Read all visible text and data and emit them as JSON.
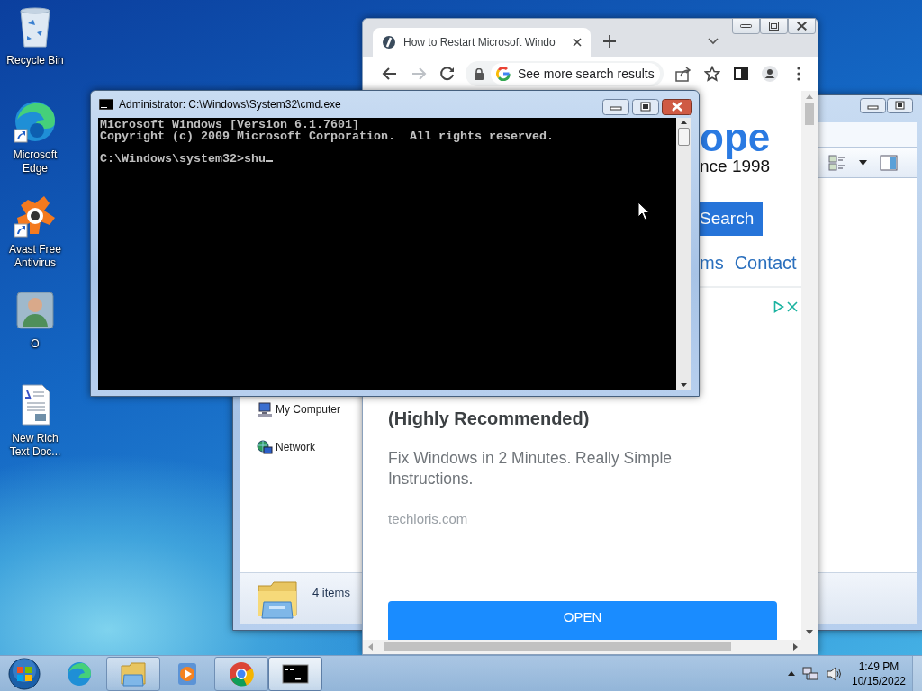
{
  "desktop_icons": [
    {
      "kind": "recycle-bin",
      "label": "Recycle Bin",
      "shortcut": false
    },
    {
      "kind": "edge",
      "label": "Microsoft Edge",
      "shortcut": true
    },
    {
      "kind": "avast",
      "label": "Avast Free Antivirus",
      "shortcut": true
    },
    {
      "kind": "user",
      "label": "O",
      "shortcut": false
    },
    {
      "kind": "document",
      "label": "New Rich Text Doc...",
      "shortcut": false
    }
  ],
  "explorer": {
    "nav_items": [
      {
        "kind": "computer",
        "label": "My Computer"
      },
      {
        "kind": "network",
        "label": "Network"
      }
    ],
    "status": "4 items"
  },
  "browser": {
    "tab_title": "How to Restart Microsoft Windo",
    "nav_buttons": [
      {
        "kind": "back",
        "disabled": false
      },
      {
        "kind": "forward",
        "disabled": true
      },
      {
        "kind": "reload",
        "disabled": false
      }
    ],
    "omnibox": "See more search results",
    "page": {
      "logo_fragment": "ope",
      "tagline_fragment": "nce 1998",
      "search_button": "Search",
      "nav_links": [
        "ms",
        "Contact"
      ],
      "ad": {
        "headline": "(Highly Recommended)",
        "description": "Fix Windows in 2 Minutes. Really Simple Instructions.",
        "domain": "techloris.com",
        "button": "OPEN"
      }
    }
  },
  "console": {
    "title": "Administrator: C:\\Windows\\System32\\cmd.exe",
    "output": [
      "Microsoft Windows [Version 6.1.7601]",
      "Copyright (c) 2009 Microsoft Corporation.  All rights reserved."
    ],
    "prompt": "C:\\Windows\\system32>shu"
  },
  "taskbar": {
    "items": [
      {
        "kind": "edge",
        "running": false,
        "selected": false
      },
      {
        "kind": "explorer",
        "running": true,
        "selected": false
      },
      {
        "kind": "media-player",
        "running": false,
        "selected": false
      },
      {
        "kind": "chrome",
        "running": true,
        "selected": false
      },
      {
        "kind": "cmd",
        "running": true,
        "selected": true
      }
    ],
    "clock": {
      "time": "1:49 PM",
      "date": "10/15/2022"
    }
  }
}
